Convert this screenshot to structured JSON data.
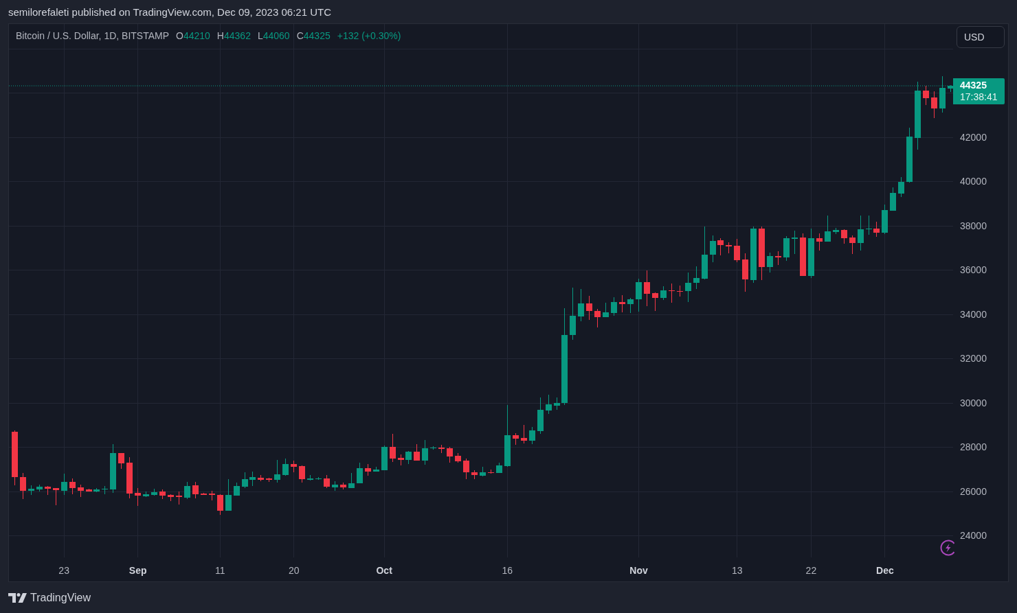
{
  "header": {
    "text": "semilorefaleti published on TradingView.com, Dec 09, 2023 06:21 UTC"
  },
  "chart": {
    "legend": {
      "symbol": "Bitcoin / U.S. Dollar, 1D, BITSTAMP",
      "positive": true,
      "values": [
        {
          "label": "O",
          "value": "44210"
        },
        {
          "label": "H",
          "value": "44362"
        },
        {
          "label": "L",
          "value": "44060"
        },
        {
          "label": "C",
          "value": "44325"
        }
      ],
      "change": "+132 (+0.30%)"
    },
    "currency_button": "USD",
    "countdown": "17:38:41",
    "date_label_is_month": [
      false,
      true,
      false,
      false,
      true,
      false,
      true,
      false,
      false,
      true
    ],
    "chart_data": {
      "type": "candlestick",
      "grid": true,
      "ylim": [
        23023,
        47116
      ],
      "yticks": [
        24000,
        26000,
        28000,
        30000,
        32000,
        34000,
        36000,
        38000,
        40000,
        42000
      ],
      "ref_lines": [
        {
          "axis": "y",
          "value": 44325,
          "label": "44325",
          "color": "#089981"
        }
      ],
      "categories": [
        null,
        null,
        null,
        null,
        null,
        null,
        "23",
        null,
        null,
        null,
        null,
        null,
        null,
        null,
        null,
        "Sep",
        null,
        null,
        null,
        null,
        null,
        null,
        null,
        null,
        null,
        "11",
        null,
        null,
        null,
        null,
        null,
        null,
        null,
        null,
        "20",
        null,
        null,
        null,
        null,
        null,
        null,
        null,
        null,
        null,
        null,
        "Oct",
        null,
        null,
        null,
        null,
        null,
        null,
        null,
        null,
        null,
        null,
        null,
        null,
        null,
        null,
        "16",
        null,
        null,
        null,
        null,
        null,
        null,
        null,
        null,
        null,
        null,
        null,
        null,
        null,
        null,
        null,
        "Nov",
        null,
        null,
        null,
        null,
        null,
        null,
        null,
        null,
        null,
        null,
        null,
        "13",
        null,
        null,
        null,
        null,
        null,
        null,
        null,
        null,
        "22",
        null,
        null,
        null,
        null,
        null,
        null,
        null,
        null,
        "Dec",
        null,
        null,
        null,
        null,
        null,
        null,
        null,
        null
      ],
      "ohlc": [
        [
          28690,
          28760,
          26290,
          26640
        ],
        [
          26660,
          26830,
          25650,
          26040
        ],
        [
          26040,
          26270,
          25830,
          26130
        ],
        [
          26100,
          26310,
          26010,
          26220
        ],
        [
          26230,
          26260,
          25850,
          26110
        ],
        [
          26140,
          26160,
          25390,
          26050
        ],
        [
          26040,
          26810,
          25830,
          26440
        ],
        [
          26440,
          26590,
          25880,
          26160
        ],
        [
          26190,
          26310,
          25760,
          26040
        ],
        [
          26080,
          26130,
          25990,
          26010
        ],
        [
          26010,
          26170,
          25980,
          26100
        ],
        [
          26080,
          26250,
          25880,
          26130
        ],
        [
          26100,
          28130,
          25950,
          27740
        ],
        [
          27740,
          27750,
          27020,
          27280
        ],
        [
          27300,
          27550,
          25700,
          25910
        ],
        [
          25950,
          26160,
          25360,
          25800
        ],
        [
          25790,
          25990,
          25750,
          25880
        ],
        [
          25850,
          26120,
          25820,
          25980
        ],
        [
          26010,
          26100,
          25670,
          25820
        ],
        [
          25860,
          25870,
          25580,
          25760
        ],
        [
          25800,
          26000,
          25420,
          25760
        ],
        [
          25730,
          26430,
          25650,
          26250
        ],
        [
          26280,
          26430,
          25680,
          25880
        ],
        [
          25900,
          25950,
          25840,
          25860
        ],
        [
          25900,
          26030,
          25610,
          25830
        ],
        [
          25850,
          25890,
          24960,
          25140
        ],
        [
          25140,
          26560,
          25130,
          25850
        ],
        [
          25820,
          26410,
          25800,
          26250
        ],
        [
          26210,
          26870,
          26160,
          26570
        ],
        [
          26530,
          26900,
          26260,
          26640
        ],
        [
          26620,
          26750,
          26460,
          26530
        ],
        [
          26600,
          26610,
          26430,
          26530
        ],
        [
          26530,
          27430,
          26410,
          26780
        ],
        [
          26740,
          27480,
          26700,
          27240
        ],
        [
          27250,
          27390,
          26870,
          27120
        ],
        [
          27150,
          27170,
          26410,
          26560
        ],
        [
          26530,
          26740,
          26500,
          26590
        ],
        [
          26560,
          26640,
          26520,
          26590
        ],
        [
          26590,
          26730,
          26160,
          26220
        ],
        [
          26190,
          26460,
          26020,
          26310
        ],
        [
          26300,
          26400,
          26100,
          26180
        ],
        [
          26170,
          26840,
          26140,
          26380
        ],
        [
          26360,
          27300,
          26360,
          27050
        ],
        [
          27050,
          27240,
          26700,
          26910
        ],
        [
          26910,
          27120,
          26900,
          26990
        ],
        [
          26960,
          28070,
          26950,
          28010
        ],
        [
          28010,
          28600,
          27330,
          27480
        ],
        [
          27510,
          27670,
          27170,
          27420
        ],
        [
          27420,
          27820,
          27230,
          27790
        ],
        [
          27790,
          28140,
          27380,
          27390
        ],
        [
          27390,
          28320,
          27200,
          27950
        ],
        [
          27940,
          28040,
          27890,
          27980
        ],
        [
          27980,
          28100,
          27730,
          27920
        ],
        [
          27950,
          28010,
          27300,
          27580
        ],
        [
          27610,
          27730,
          27300,
          27360
        ],
        [
          27390,
          27480,
          26550,
          26860
        ],
        [
          26860,
          26950,
          26550,
          26740
        ],
        [
          26710,
          27110,
          26680,
          26860
        ],
        [
          26860,
          26990,
          26800,
          26830
        ],
        [
          26830,
          27300,
          26830,
          27170
        ],
        [
          27140,
          29910,
          27130,
          28540
        ],
        [
          28540,
          28630,
          28100,
          28380
        ],
        [
          28410,
          29000,
          28170,
          28290
        ],
        [
          28290,
          28910,
          28130,
          28760
        ],
        [
          28720,
          30250,
          28600,
          29690
        ],
        [
          29660,
          30370,
          29500,
          29940
        ],
        [
          29880,
          30250,
          29690,
          30000
        ],
        [
          30000,
          34290,
          29910,
          33080
        ],
        [
          33080,
          35220,
          32860,
          33950
        ],
        [
          33910,
          35160,
          33700,
          34510
        ],
        [
          34510,
          34850,
          33760,
          34160
        ],
        [
          34160,
          34260,
          33420,
          33880
        ],
        [
          33880,
          34540,
          33870,
          34100
        ],
        [
          34070,
          34790,
          33950,
          34570
        ],
        [
          34570,
          34880,
          34100,
          34480
        ],
        [
          34480,
          34750,
          34070,
          34690
        ],
        [
          34670,
          35620,
          34130,
          35470
        ],
        [
          35470,
          35990,
          34360,
          34920
        ],
        [
          34970,
          34980,
          34170,
          34730
        ],
        [
          34730,
          35280,
          34640,
          35090
        ],
        [
          35090,
          35410,
          34520,
          35040
        ],
        [
          35060,
          35310,
          34800,
          35040
        ],
        [
          35040,
          35900,
          34550,
          35440
        ],
        [
          35420,
          36180,
          35140,
          35650
        ],
        [
          35620,
          37980,
          35590,
          36710
        ],
        [
          36690,
          37580,
          36370,
          37330
        ],
        [
          37360,
          37450,
          36680,
          37140
        ],
        [
          37140,
          37270,
          36770,
          37080
        ],
        [
          37110,
          37420,
          36370,
          36460
        ],
        [
          36490,
          36770,
          35030,
          35570
        ],
        [
          35540,
          37980,
          35420,
          37890
        ],
        [
          37890,
          37980,
          35560,
          36150
        ],
        [
          36150,
          36800,
          35900,
          36650
        ],
        [
          36650,
          36860,
          36240,
          36580
        ],
        [
          36580,
          37550,
          36430,
          37450
        ],
        [
          37420,
          37790,
          36740,
          37480
        ],
        [
          37480,
          37670,
          35740,
          35750
        ],
        [
          35750,
          37890,
          35650,
          37450
        ],
        [
          37450,
          37670,
          36890,
          37300
        ],
        [
          37300,
          38450,
          37290,
          37760
        ],
        [
          37730,
          37920,
          37640,
          37820
        ],
        [
          37820,
          37860,
          37200,
          37450
        ],
        [
          37480,
          37580,
          36740,
          37240
        ],
        [
          37240,
          38450,
          36890,
          37860
        ],
        [
          37870,
          38480,
          37610,
          37890
        ],
        [
          37890,
          38200,
          37510,
          37700
        ],
        [
          37700,
          38950,
          37630,
          38710
        ],
        [
          38690,
          39740,
          38680,
          39490
        ],
        [
          39470,
          40210,
          39300,
          39990
        ],
        [
          39970,
          42430,
          39960,
          42020
        ],
        [
          41960,
          44520,
          41440,
          44120
        ],
        [
          44120,
          44330,
          43460,
          43780
        ],
        [
          43800,
          44080,
          42880,
          43310
        ],
        [
          43310,
          44770,
          43130,
          44240
        ],
        [
          44210,
          44360,
          44060,
          44330
        ]
      ]
    }
  },
  "footer": {
    "brand": "TradingView"
  }
}
